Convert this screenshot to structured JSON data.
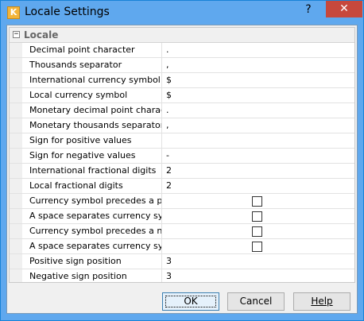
{
  "window": {
    "title": "Locale Settings",
    "help_glyph": "?",
    "close_glyph": "✕",
    "icon_glyph": "K"
  },
  "grid": {
    "category": {
      "label": "Locale",
      "expander": "−"
    },
    "rows": [
      {
        "name": "Decimal point character",
        "value": "."
      },
      {
        "name": "Thousands separator",
        "value": ","
      },
      {
        "name": "International currency symbol",
        "value": "$"
      },
      {
        "name": "Local currency symbol",
        "value": "$"
      },
      {
        "name": "Monetary decimal point character",
        "value": "."
      },
      {
        "name": "Monetary thousands separator",
        "value": ","
      },
      {
        "name": "Sign for positive values",
        "value": ""
      },
      {
        "name": "Sign for negative values",
        "value": "-"
      },
      {
        "name": "International fractional digits",
        "value": "2"
      },
      {
        "name": "Local fractional digits",
        "value": "2"
      },
      {
        "name": "Currency symbol precedes a posit",
        "checked": false
      },
      {
        "name": "A space separates currency symb",
        "checked": false
      },
      {
        "name": "Currency symbol precedes a nega",
        "checked": false
      },
      {
        "name": "A space separates currency symb",
        "checked": false
      },
      {
        "name": "Positive sign position",
        "value": "3"
      },
      {
        "name": "Negative sign position",
        "value": "3"
      }
    ]
  },
  "buttons": {
    "ok": "OK",
    "cancel": "Cancel",
    "help": "Help"
  },
  "colors": {
    "titlebar": "#5fa8ee",
    "close": "#c7483c"
  }
}
